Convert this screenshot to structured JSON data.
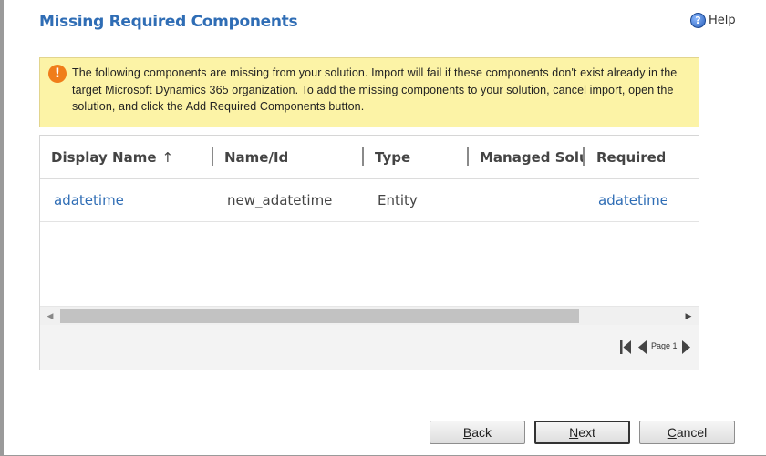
{
  "dialog": {
    "title": "Missing Required Components",
    "help_label": "Help",
    "help_icon": "help-question-icon"
  },
  "warning": {
    "icon": "exclamation-warning-icon",
    "text": "The following components are missing from your solution. Import will fail if these components don't exist already in the target Microsoft Dynamics 365 organization. To add the missing components to your solution, cancel import, open the solution, and click the Add Required Components button."
  },
  "grid": {
    "columns": [
      {
        "label": "Display Name",
        "sort": "ascending"
      },
      {
        "label": "Name/Id"
      },
      {
        "label": "Type"
      },
      {
        "label": "Managed Solut"
      },
      {
        "label": "Required l"
      }
    ],
    "rows": [
      {
        "display_name": "adatetime",
        "name_id": "new_adatetime",
        "type": "Entity",
        "managed_solution": "",
        "required_by": "adatetime"
      }
    ],
    "sort_arrow": "↑",
    "pager": {
      "page_label": "Page 1"
    }
  },
  "buttons": {
    "back": {
      "mnemonic": "B",
      "rest": "ack"
    },
    "next": {
      "mnemonic": "N",
      "rest": "ext"
    },
    "cancel": {
      "mnemonic": "C",
      "rest": "ancel"
    }
  },
  "colors": {
    "title_blue": "#2f6db5",
    "warning_bg": "#fcf3a6",
    "warning_icon": "#f07d1a",
    "link_blue": "#2f6db5"
  }
}
